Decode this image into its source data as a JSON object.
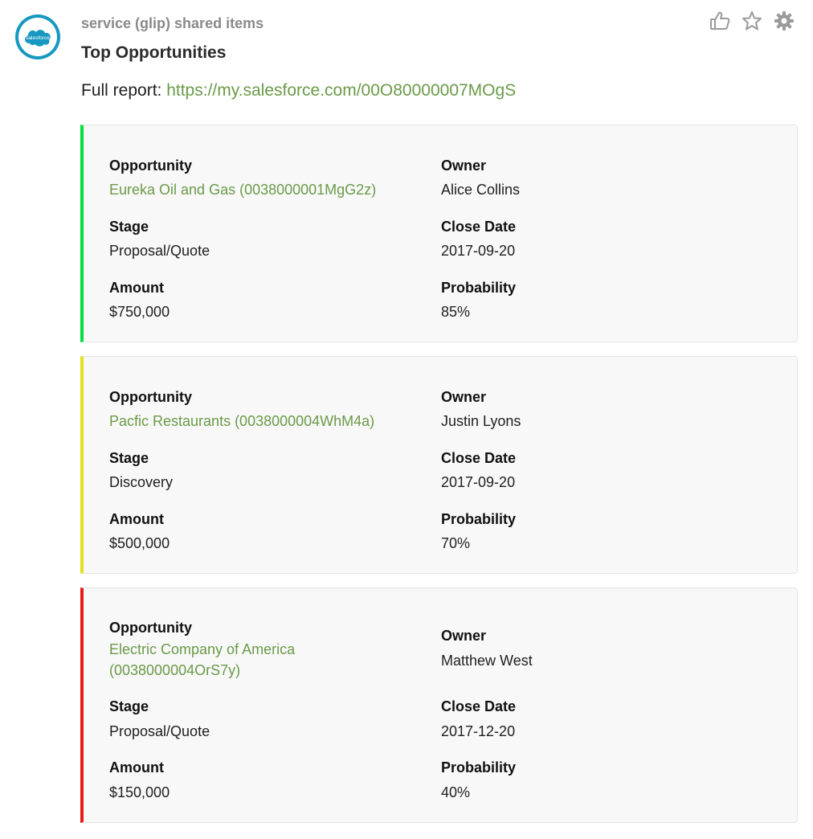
{
  "post": {
    "sender": "service (glip) shared items",
    "title": "Top Opportunities",
    "report_prefix": "Full report: ",
    "report_link": "https://my.salesforce.com/00O80000007MOgS",
    "avatar_icon": "salesforce-logo-icon",
    "avatar_text": "salesforce"
  },
  "actions": [
    {
      "icon": "thumbs-up-icon"
    },
    {
      "icon": "star-icon"
    },
    {
      "icon": "gear-icon"
    }
  ],
  "labels": {
    "opportunity": "Opportunity",
    "owner": "Owner",
    "stage": "Stage",
    "close_date": "Close Date",
    "amount": "Amount",
    "probability": "Probability"
  },
  "cards": [
    {
      "accent": "#00e03c",
      "opportunity": "Eureka Oil and Gas (0038000001MgG2z)",
      "owner": "Alice Collins",
      "stage": "Proposal/Quote",
      "close_date": "2017-09-20",
      "amount": "$750,000",
      "probability": "85%"
    },
    {
      "accent": "#e3e01c",
      "opportunity": "Pacfic Restaurants (0038000004WhM4a)",
      "owner": "Justin Lyons",
      "stage": "Discovery",
      "close_date": "2017-09-20",
      "amount": "$500,000",
      "probability": "70%"
    },
    {
      "accent": "#e81c1c",
      "opportunity": "Electric Company of America (0038000004OrS7y)",
      "owner": "Matthew West",
      "stage": "Proposal/Quote",
      "close_date": "2017-12-20",
      "amount": "$150,000",
      "probability": "40%"
    }
  ]
}
